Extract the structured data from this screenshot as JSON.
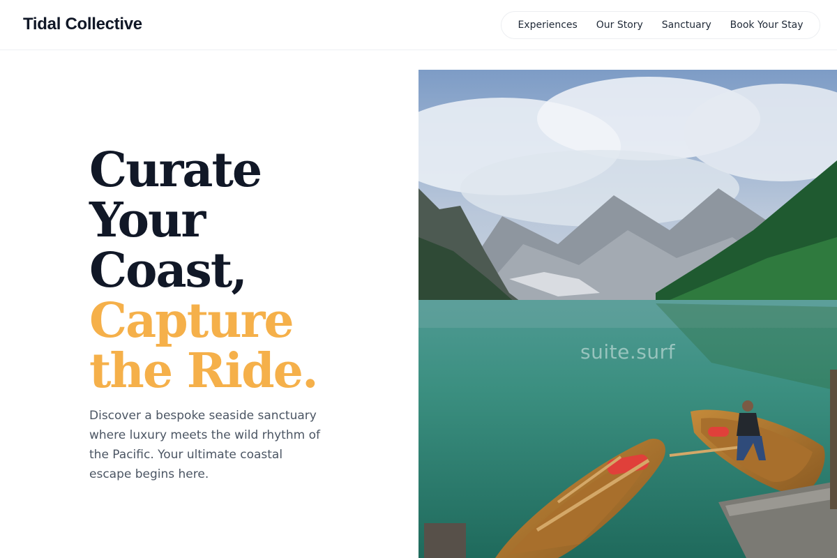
{
  "brand": {
    "name": "Tidal Collective"
  },
  "nav": {
    "items": [
      {
        "label": "Experiences"
      },
      {
        "label": "Our Story"
      },
      {
        "label": "Sanctuary"
      },
      {
        "label": "Book Your Stay"
      }
    ]
  },
  "hero": {
    "headline": {
      "line1": "Curate",
      "line2": "Your",
      "line3": "Coast,",
      "accent1": "Capture",
      "accent2": "the Ride."
    },
    "description": "Discover a bespoke seaside sanctuary where luxury meets the wild rhythm of the Pacific. Your ultimate coastal escape begins here.",
    "image": {
      "watermark": "suite.surf",
      "subject": "alpine lake with wooden rowboats"
    }
  },
  "colors": {
    "accent": "#f5b04a",
    "heading": "#111827",
    "body": "#4b5563"
  }
}
